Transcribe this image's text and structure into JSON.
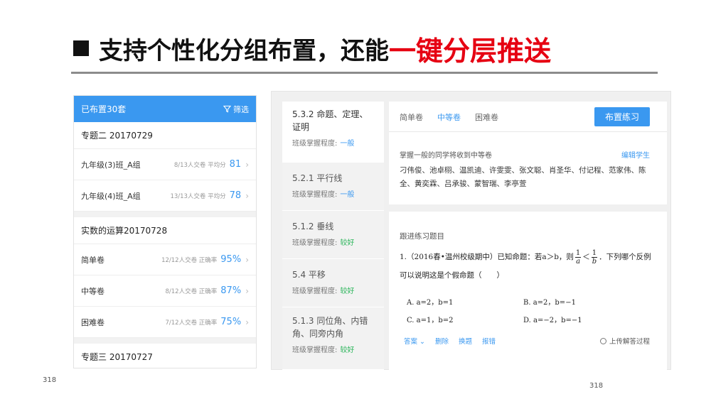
{
  "slide": {
    "title_prefix": "支持个性化分组布置，还能",
    "title_highlight": "一键分层推送",
    "page_left": "318",
    "page_right": "318"
  },
  "left_panel": {
    "header": "已布置30套",
    "filter_label": "筛选",
    "groups": [
      {
        "title": "专题二 20170729",
        "rows": [
          {
            "name": "九年级(3)班_A组",
            "meta": "8/13人交卷  平均分",
            "value": "81"
          },
          {
            "name": "九年级(4)班_A组",
            "meta": "13/13人交卷  平均分",
            "value": "78"
          }
        ]
      },
      {
        "title": "实数的运算20170728",
        "rows": [
          {
            "name": "简单卷",
            "meta": "12/12人交卷  正确率",
            "value": "95%"
          },
          {
            "name": "中等卷",
            "meta": "8/12人交卷  正确率",
            "value": "87%"
          },
          {
            "name": "困难卷",
            "meta": "7/12人交卷  正确率",
            "value": "75%"
          }
        ]
      },
      {
        "title": "专题三 20170727",
        "rows": []
      }
    ]
  },
  "topics": [
    {
      "name": "5.3.2 命题、定理、证明",
      "level_label": "班级掌握程度:",
      "level": "一般",
      "level_type": "ok"
    },
    {
      "name": "5.2.1 平行线",
      "level_label": "班级掌握程度:",
      "level": "一般",
      "level_type": "ok"
    },
    {
      "name": "5.1.2 垂线",
      "level_label": "班级掌握程度:",
      "level": "较好",
      "level_type": "good"
    },
    {
      "name": "5.4 平移",
      "level_label": "班级掌握程度:",
      "level": "较好",
      "level_type": "good"
    },
    {
      "name": "5.1.3 同位角、内错角、同旁内角",
      "level_label": "班级掌握程度:",
      "level": "较好",
      "level_type": "good"
    }
  ],
  "detail": {
    "tabs": [
      "简单卷",
      "中等卷",
      "困难卷"
    ],
    "active_tab": "中等卷",
    "assign_button": "布置练习",
    "hint": "掌握一般的同学将收到中等卷",
    "edit_link": "编辑学生",
    "students": "刁伟俊、池卓栩、温凯迪、许雯雯、张文聪、肖圣华、付记程、范家伟、陈全、黄奕霖、吕承骏、蒙智瑞、李亭萱",
    "follow_label": "跟进练习题目",
    "question_prefix": "1.（2016春•温州校级期中）已知命题：若a＞b，则",
    "frac_a_num": "1",
    "frac_a_den": "a",
    "lt": "＜",
    "frac_b_num": "1",
    "frac_b_den": "b",
    "question_suffix": "．下列哪个反例可以说明这是个假命题（　　）",
    "options": [
      "A.  a=2，b=1",
      "B.  a=2，b=−1",
      "C.  a=1，b=2",
      "D.  a=−2，b=−1"
    ],
    "actions": [
      "答案",
      "删除",
      "换题",
      "报错"
    ],
    "upload_label": "上传解答过程"
  },
  "colors": {
    "accent": "#3a98f0",
    "highlight": "#e60012",
    "good": "#2bb55a"
  }
}
